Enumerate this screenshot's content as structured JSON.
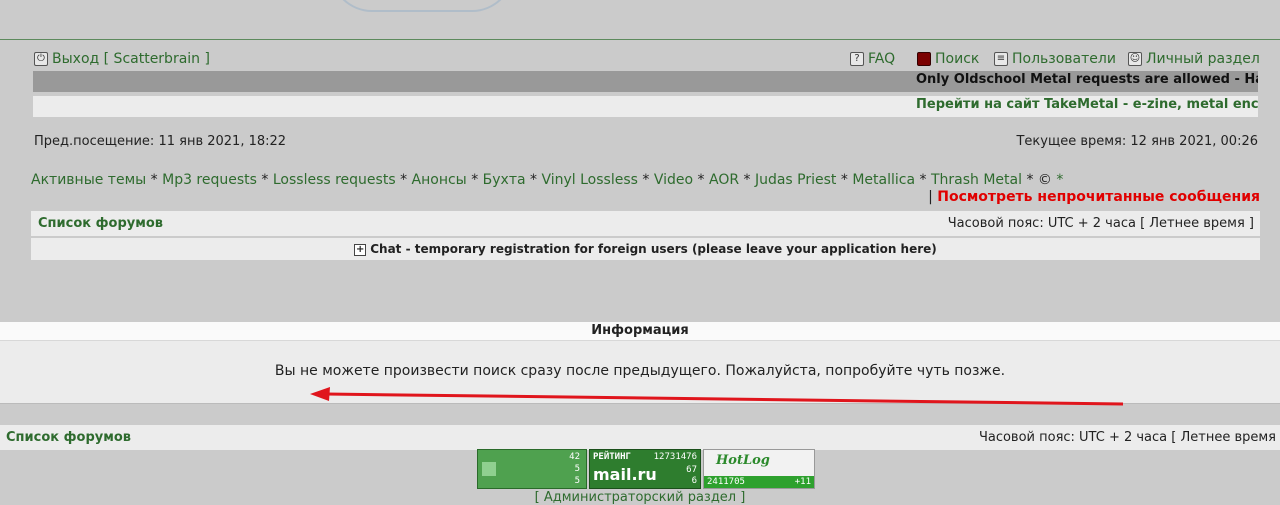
{
  "nav": {
    "logout": "Выход [ Scatterbrain ]",
    "faq": "FAQ",
    "search": "Поиск",
    "users": "Пользователи",
    "profile": "Личный раздел"
  },
  "banners": {
    "first": "Only Oldschool Metal requests are allowed - Hard",
    "second": "Перейти на сайт TakeMetal - e-zine, metal ency"
  },
  "visit": {
    "last": "Пред.посещение: 11 янв 2021, 18:22",
    "current": "Текущее время: 12 янв 2021, 00:26"
  },
  "quicklinks": [
    "Активные темы",
    "Mp3 requests",
    "Lossless requests",
    "Анонсы",
    "Бухта",
    "Vinyl Lossless",
    "Video",
    "AOR",
    "Judas Priest",
    "Metallica",
    "Thrash Metal"
  ],
  "quicklinks_tail": "©",
  "quicklinks_star": "*",
  "unread": {
    "bar": "|",
    "label": "Посмотреть непрочитанные сообщения"
  },
  "forum_bar": {
    "title": "Список форумов",
    "timezone": "Часовой пояс: UTC + 2 часа [ Летнее время ]",
    "timezone_bottom": "Часовой пояс: UTC + 2 часа [ Летнее время"
  },
  "chat_link": "Chat - temporary registration for foreign users (please leave your application here)",
  "info": {
    "title": "Информация",
    "message": "Вы не можете произвести поиск сразу после предыдущего. Пожалуйста, попробуйте чуть позже."
  },
  "counters": {
    "c1_lines": [
      "42",
      "5",
      "5"
    ],
    "c2_title": "РЕЙТИНГ",
    "c2_num": "12731476",
    "c2_brand": "mail.ru",
    "c2_a": "67",
    "c2_b": "6",
    "c3_brand": "HotLog",
    "c3_num": "2411705",
    "c3_plus": "+11"
  },
  "admin": "[ Администраторский раздел ]",
  "colors": {
    "link": "#2e6b2e",
    "alert": "#e00000",
    "arrow": "#e0151c"
  }
}
